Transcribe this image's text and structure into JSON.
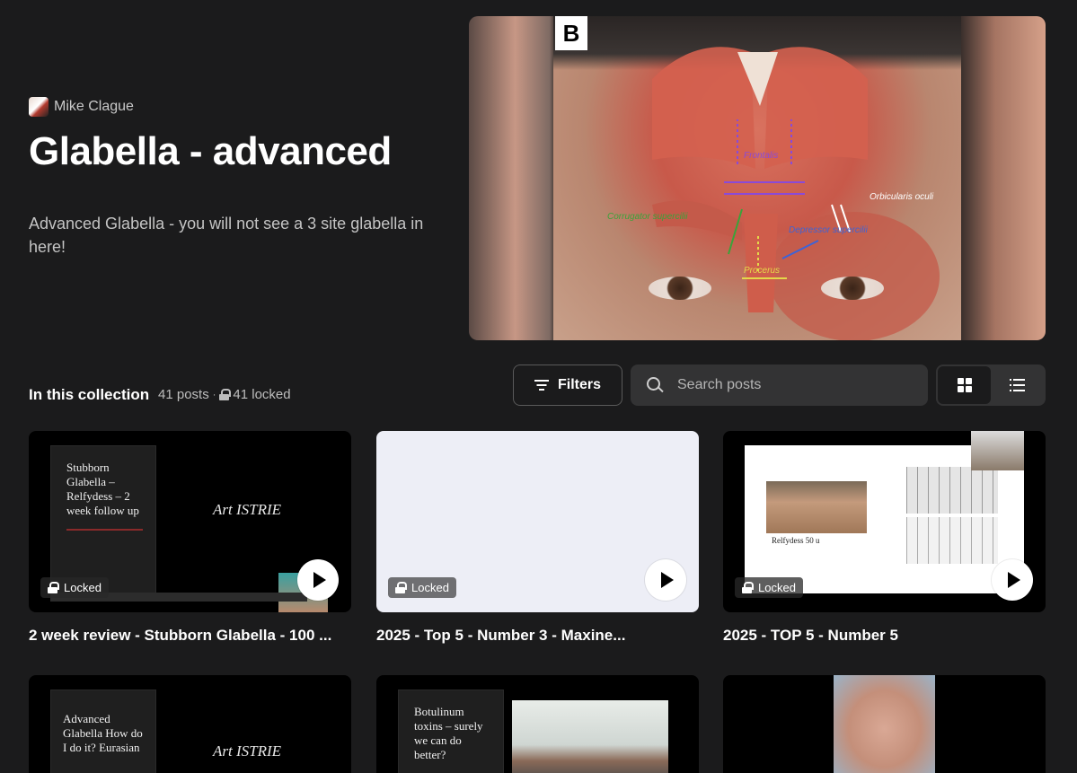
{
  "author": {
    "name": "Mike Clague"
  },
  "collection": {
    "title": "Glabella - advanced",
    "description": "Advanced Glabella - you will not see a 3 site glabella in here!",
    "section_label": "In this collection",
    "posts_count": "41 posts",
    "separator": "·",
    "locked_count": "41 locked"
  },
  "hero": {
    "panel_letter": "B",
    "labels": {
      "frontalis": "Frontalis",
      "orbicularis": "Orbicularis oculi",
      "corrugator": "Corrugator supercilii",
      "depressor": "Depressor supercilii",
      "procerus": "Procerus"
    }
  },
  "toolbar": {
    "filters_label": "Filters",
    "search_placeholder": "Search posts"
  },
  "cards": [
    {
      "title": "2 week review - Stubborn Glabella - 100 ...",
      "badge": "Locked",
      "slide_text": "Stubborn Glabella – Relfydess – 2 week follow up",
      "logo_text": "Art ISTRIE"
    },
    {
      "title": "2025 - Top 5 - Number 3 - Maxine...",
      "badge": "Locked"
    },
    {
      "title": "2025 - TOP 5 - Number 5",
      "badge": "Locked",
      "slide_caption": "Relfydess 50 u"
    },
    {
      "slide_text": "Advanced Glabella How do I do it? Eurasian",
      "logo_text": "Art ISTRIE"
    },
    {
      "slide_text": "Botulinum toxins – surely we can do better?"
    },
    {}
  ]
}
